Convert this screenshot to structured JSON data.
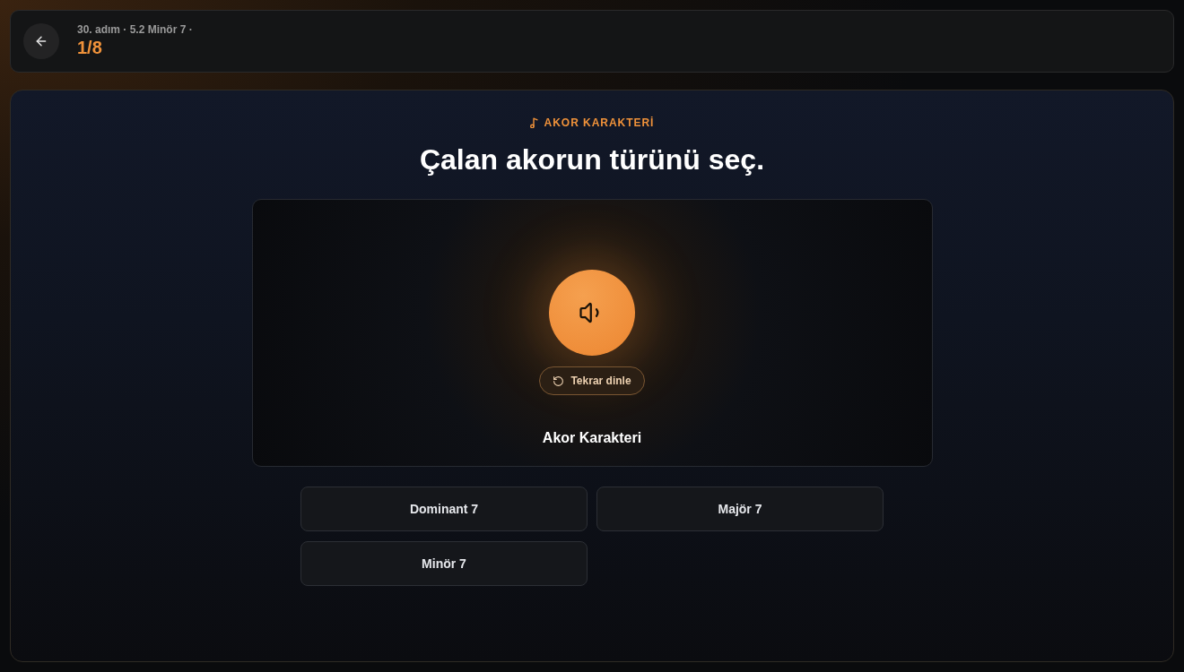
{
  "header": {
    "breadcrumb": "30. adım · 5.2 Minör 7 ·",
    "progress": "1/8"
  },
  "question": {
    "category": "AKOR KARAKTERİ",
    "prompt": "Çalan akorun türünü seç."
  },
  "player": {
    "replay_label": "Tekrar dinle",
    "caption": "Akor Karakteri"
  },
  "options": [
    {
      "label": "Dominant 7",
      "selected": false
    },
    {
      "label": "Majör 7",
      "selected": false
    },
    {
      "label": "Minör 7",
      "selected": false
    }
  ]
}
